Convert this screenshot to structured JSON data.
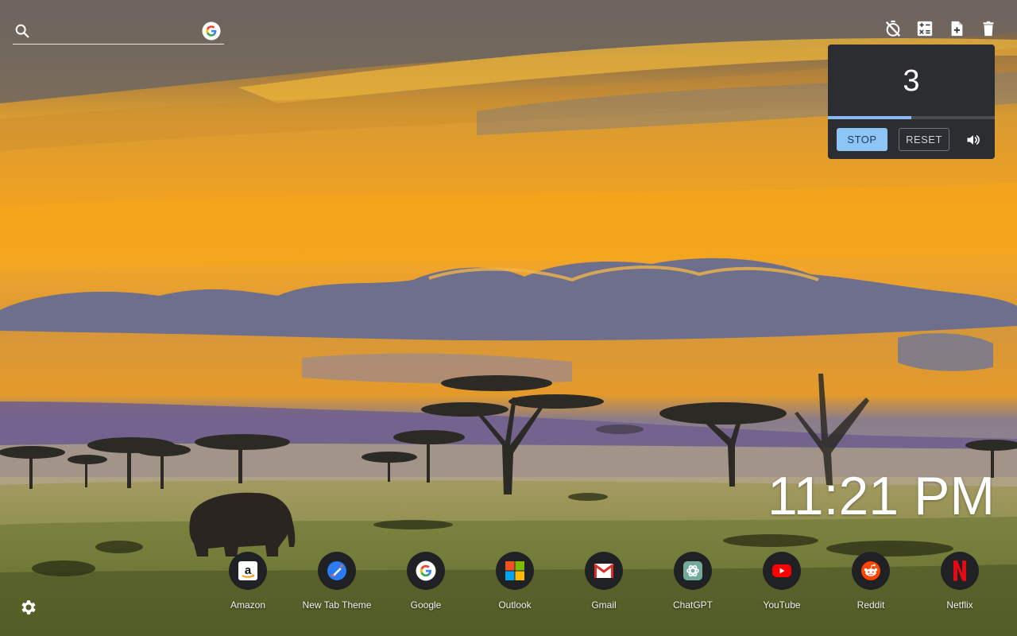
{
  "search": {
    "placeholder": "",
    "value": "",
    "engine_icon": "google-g-icon"
  },
  "toolbar": {
    "icons": [
      "timer-off-icon",
      "calculator-icon",
      "new-note-icon",
      "trash-icon"
    ]
  },
  "timer": {
    "count": "3",
    "progress": 0.5,
    "stop_label": "STOP",
    "reset_label": "RESET",
    "volume_icon": "volume-icon"
  },
  "clock": {
    "time": "11:21 PM"
  },
  "shortcuts": [
    {
      "label": "Amazon",
      "icon": "amazon-icon"
    },
    {
      "label": "New Tab Theme",
      "icon": "new-tab-theme-icon"
    },
    {
      "label": "Google",
      "icon": "google-icon"
    },
    {
      "label": "Outlook",
      "icon": "outlook-icon"
    },
    {
      "label": "Gmail",
      "icon": "gmail-icon"
    },
    {
      "label": "ChatGPT",
      "icon": "chatgpt-icon"
    },
    {
      "label": "YouTube",
      "icon": "youtube-icon"
    },
    {
      "label": "Reddit",
      "icon": "reddit-icon"
    },
    {
      "label": "Netflix",
      "icon": "netflix-icon"
    }
  ],
  "colors": {
    "widget_bg": "#2b2d31",
    "stop_button": "#8ec5f7",
    "progress_fill": "#8ab8f0",
    "shortcut_circle": "#202124"
  },
  "settings": {
    "icon": "gear-icon"
  }
}
